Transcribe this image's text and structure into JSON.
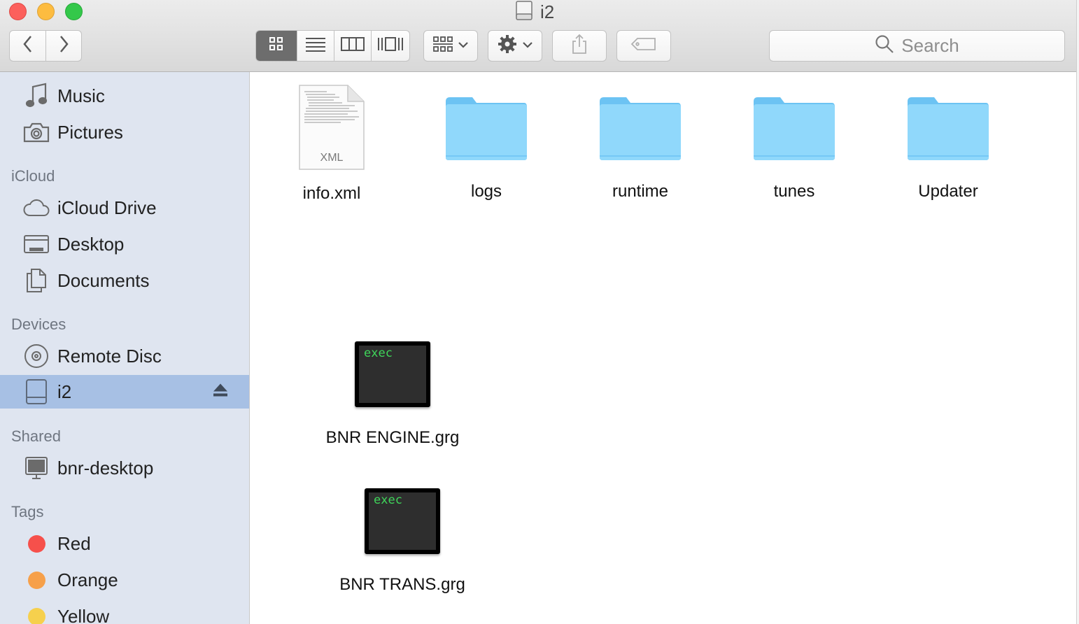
{
  "window": {
    "title": "i2",
    "title_icon": "drive-icon"
  },
  "toolbar": {
    "back_icon": "chevron-left-icon",
    "forward_icon": "chevron-right-icon",
    "views": [
      {
        "name": "icon-view",
        "icon": "grid-icon",
        "active": true
      },
      {
        "name": "list-view",
        "icon": "list-icon",
        "active": false
      },
      {
        "name": "column-view",
        "icon": "columns-icon",
        "active": false
      },
      {
        "name": "cover-flow-view",
        "icon": "coverflow-icon",
        "active": false
      }
    ],
    "arrange_icon": "arrange-icon",
    "action_icon": "gear-icon",
    "share_icon": "share-icon",
    "tag_icon": "tag-icon",
    "search_placeholder": "Search"
  },
  "sidebar": {
    "favorites": [
      {
        "label": "Music",
        "icon": "music-note-icon"
      },
      {
        "label": "Pictures",
        "icon": "camera-icon"
      }
    ],
    "icloud_header": "iCloud",
    "icloud": [
      {
        "label": "iCloud Drive",
        "icon": "cloud-icon"
      },
      {
        "label": "Desktop",
        "icon": "desktop-folder-icon"
      },
      {
        "label": "Documents",
        "icon": "documents-icon"
      }
    ],
    "devices_header": "Devices",
    "devices": [
      {
        "label": "Remote Disc",
        "icon": "disc-icon"
      },
      {
        "label": "i2",
        "icon": "drive-icon",
        "selected": true,
        "eject": true
      }
    ],
    "shared_header": "Shared",
    "shared": [
      {
        "label": "bnr-desktop",
        "icon": "monitor-icon"
      }
    ],
    "tags_header": "Tags",
    "tags": [
      {
        "label": "Red",
        "color": "#f6504b"
      },
      {
        "label": "Orange",
        "color": "#f6a04a"
      },
      {
        "label": "Yellow",
        "color": "#f6d04d"
      }
    ]
  },
  "files": [
    {
      "name": "info.xml",
      "kind": "xml-document",
      "badge": "XML"
    },
    {
      "name": "logs",
      "kind": "folder"
    },
    {
      "name": "runtime",
      "kind": "folder"
    },
    {
      "name": "tunes",
      "kind": "folder"
    },
    {
      "name": "Updater",
      "kind": "folder"
    },
    {
      "name": "BNR ENGINE.grg",
      "kind": "exec",
      "badge": "exec"
    },
    {
      "name": "BNR TRANS.grg",
      "kind": "exec",
      "badge": "exec"
    }
  ],
  "colors": {
    "sidebar_bg": "#dfe5f0",
    "selection": "#a7c0e4",
    "folder": "#7fd0f8",
    "exec_text": "#3fd55a"
  }
}
